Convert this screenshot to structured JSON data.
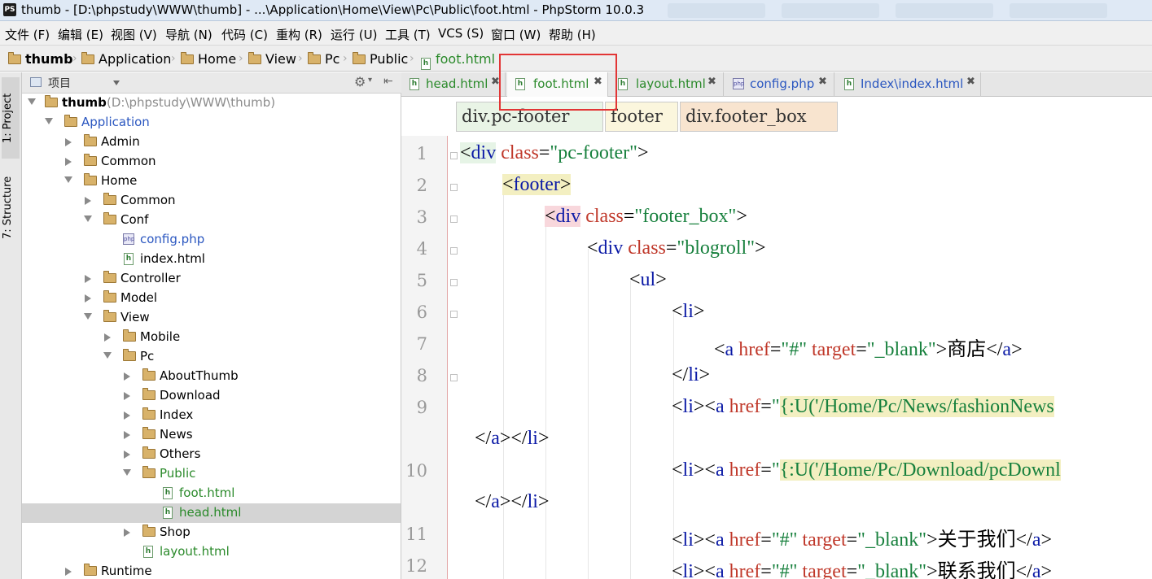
{
  "window": {
    "title": "thumb - [D:\\phpstudy\\WWW\\thumb] - ...\\Application\\Home\\View\\Pc\\Public\\foot.html - PhpStorm 10.0.3"
  },
  "menu": [
    "文件 (F)",
    "编辑 (E)",
    "视图 (V)",
    "导航 (N)",
    "代码 (C)",
    "重构 (R)",
    "运行 (U)",
    "工具 (T)",
    "VCS (S)",
    "窗口 (W)",
    "帮助 (H)"
  ],
  "breadcrumb": [
    "thumb",
    "Application",
    "Home",
    "View",
    "Pc",
    "Public",
    "foot.html"
  ],
  "toolstrip": {
    "project": "1: Project",
    "structure": "7: Structure"
  },
  "project_panel": {
    "title": "项目",
    "root_label": "thumb",
    "root_path": "(D:\\phpstudy\\WWW\\thumb)",
    "items": [
      {
        "label": "Application"
      },
      {
        "label": "Admin"
      },
      {
        "label": "Common"
      },
      {
        "label": "Home"
      },
      {
        "label": "Common"
      },
      {
        "label": "Conf"
      },
      {
        "label": "config.php"
      },
      {
        "label": "index.html"
      },
      {
        "label": "Controller"
      },
      {
        "label": "Model"
      },
      {
        "label": "View"
      },
      {
        "label": "Mobile"
      },
      {
        "label": "Pc"
      },
      {
        "label": "AboutThumb"
      },
      {
        "label": "Download"
      },
      {
        "label": "Index"
      },
      {
        "label": "News"
      },
      {
        "label": "Others"
      },
      {
        "label": "Public"
      },
      {
        "label": "foot.html"
      },
      {
        "label": "head.html"
      },
      {
        "label": "Shop"
      },
      {
        "label": "layout.html"
      },
      {
        "label": "Runtime"
      }
    ]
  },
  "tabs": [
    "head.html",
    "foot.html",
    "layout.html",
    "config.php",
    "Index\\index.html"
  ],
  "active_tab": "foot.html",
  "tag_breadcrumbs": [
    "div.pc-footer",
    "footer",
    "div.footer_box"
  ],
  "editor": {
    "line_numbers": [
      "1",
      "2",
      "3",
      "4",
      "5",
      "6",
      "7",
      "8",
      "9",
      "10",
      "11",
      "12"
    ],
    "tokens": {
      "div": "div",
      "class": "class",
      "pc_footer": "\"pc-footer\"",
      "footer": "footer",
      "footer_box": "\"footer_box\"",
      "blogroll": "\"blogroll\"",
      "ul": "ul",
      "li": "li",
      "a": "a",
      "href": "href",
      "hash": "\"#\"",
      "target": "target",
      "blank": "\"_blank\"",
      "shop": "商店",
      "news_url": "{:U('/Home/Pc/News/fashionNews",
      "download_url": "{:U('/Home/Pc/Download/pcDownl",
      "about": "关于我们",
      "contact": "联系我们",
      "quote": "\""
    }
  }
}
